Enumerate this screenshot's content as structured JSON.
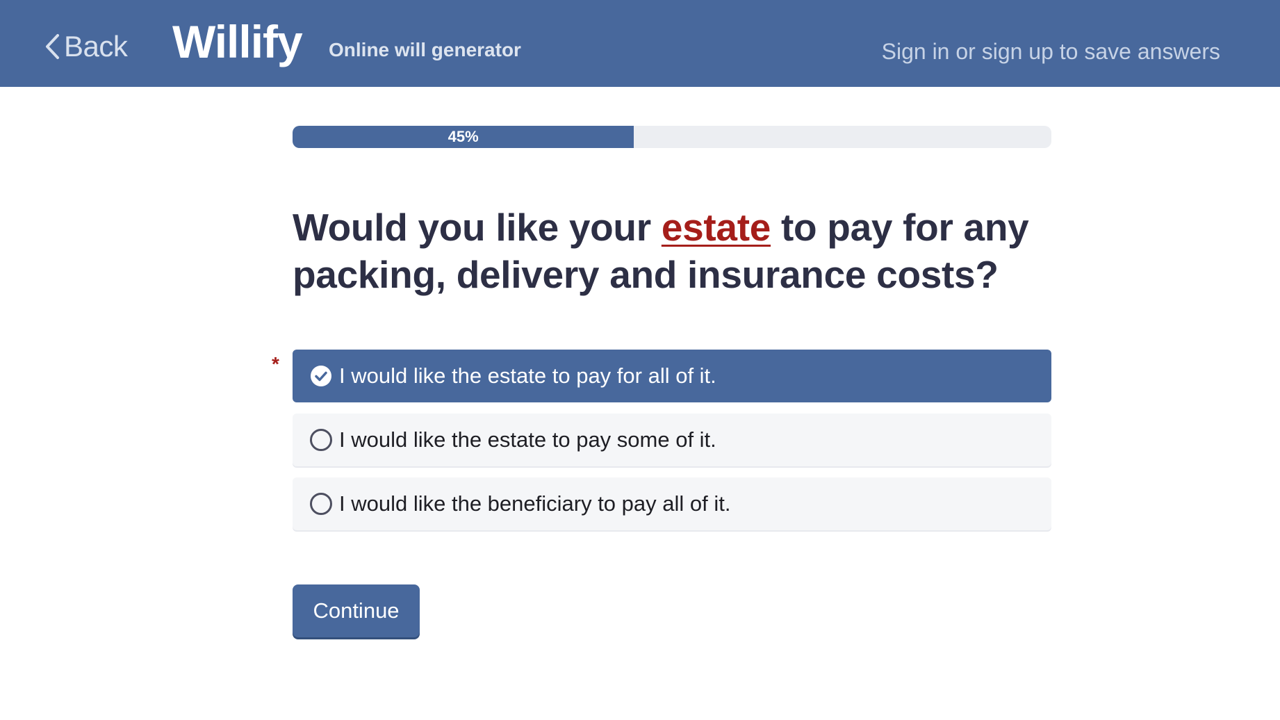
{
  "header": {
    "back_label": "Back",
    "logo": "Willify",
    "tagline": "Online will generator",
    "signin_label": "Sign in or sign up to save answers"
  },
  "progress": {
    "percent": 45,
    "label": "45%"
  },
  "question": {
    "before": "Would you like your ",
    "link_text": "estate",
    "after": " to pay for any packing, delivery and insurance costs?"
  },
  "required_marker": "*",
  "options": [
    {
      "label": "I would like the estate to pay for all of it.",
      "selected": true
    },
    {
      "label": "I would like the estate to pay some of it.",
      "selected": false
    },
    {
      "label": "I would like the beneficiary to pay all of it.",
      "selected": false
    }
  ],
  "continue_label": "Continue",
  "colors": {
    "brand": "#48689c",
    "link": "#a51e1a",
    "text": "#2d2f45"
  }
}
